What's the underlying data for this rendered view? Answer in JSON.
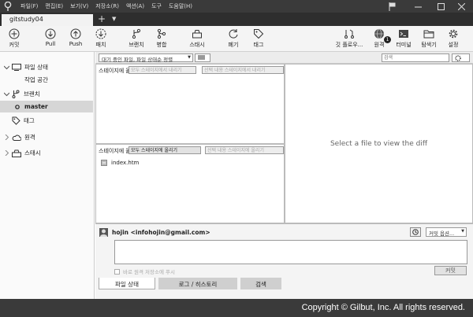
{
  "menu": [
    "파일(F)",
    "편집(E)",
    "보기(V)",
    "저장소(R)",
    "액션(A)",
    "도구",
    "도움말(H)"
  ],
  "repo_tab": "gitstudy04",
  "tab_add": "+",
  "toolbar": {
    "commit": "커밋",
    "pull": "Pull",
    "push": "Push",
    "fetch": "패치",
    "branch": "브랜치",
    "merge": "병합",
    "stash": "스태시",
    "discard": "폐기",
    "tag": "태그",
    "gitflow": "깃 플로우...",
    "remote": "원격",
    "remote_badge": "1",
    "terminal": "터미널",
    "explorer": "탐색기",
    "settings": "설정"
  },
  "sidebar": {
    "workspace": "파일 상태",
    "working_copy": "작업 공간",
    "branches": "브랜치",
    "branch_master": "master",
    "tags": "태그",
    "remotes": "원격",
    "stashes": "스태시"
  },
  "filter": {
    "status_select": "대기 중인 파일, 파일 상태순 정렬",
    "search_placeholder": "검색"
  },
  "staged": {
    "title": "스테이지에 올라간 파일",
    "unstage_all": "모두 스테이지에서 내리기",
    "unstage_selected": "선택 내용 스테이지에서 내리기"
  },
  "unstaged": {
    "title": "스테이지에 올라가지 않은 파일",
    "stage_all": "모두 스테이지에 올리기",
    "stage_selected": "선택 내용 스테이지에 올리기",
    "files": [
      "index.htm"
    ]
  },
  "diff_placeholder": "Select a file to view the diff",
  "commit": {
    "author": "hojin <infohojin@gmail.com>",
    "options": "커밋 옵션...",
    "push_checkbox": "바로 원격 저장소에 푸시",
    "commit_button": "커밋"
  },
  "bottom_tabs": [
    "파일 상태",
    "로그 / 히스토리",
    "검색"
  ],
  "copyright": "Copyright © Gilbut, Inc. All rights reserved."
}
